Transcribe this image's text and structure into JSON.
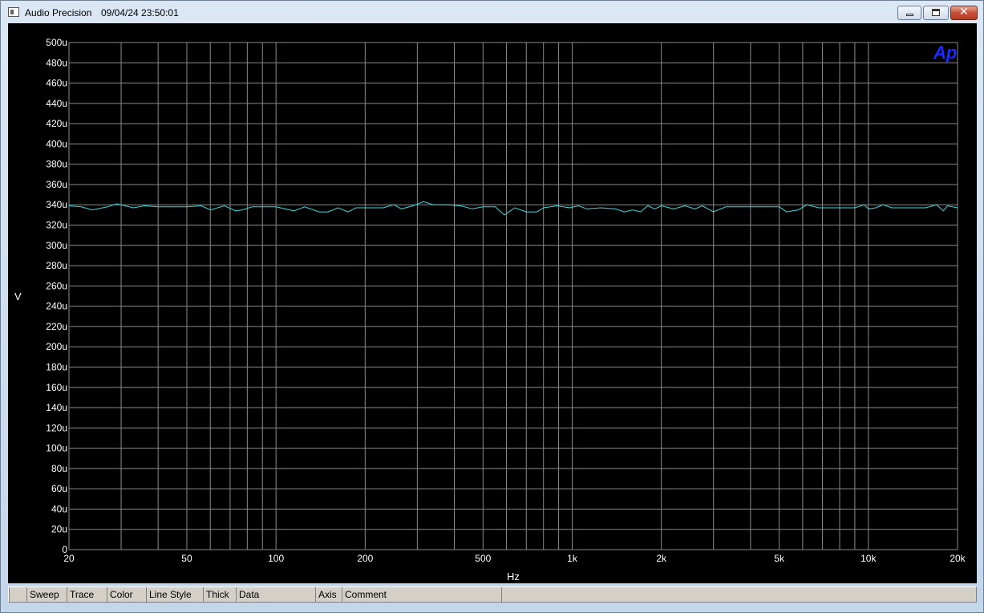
{
  "window": {
    "title": "Audio Precision",
    "timestamp": "09/04/24 23:50:01"
  },
  "chart_data": {
    "type": "line",
    "xscale": "log",
    "xlim": [
      20,
      20000
    ],
    "ylim": [
      0,
      500
    ],
    "yunit": "u",
    "xlabel": "Hz",
    "ylabel": "V",
    "grid": true,
    "logo": "Ap",
    "trace_color": "#38d9e0",
    "grid_color": "#8a8a8a",
    "y_ticks": [
      0,
      20,
      40,
      60,
      80,
      100,
      120,
      140,
      160,
      180,
      200,
      220,
      240,
      260,
      280,
      300,
      320,
      340,
      360,
      380,
      400,
      420,
      440,
      460,
      480,
      500
    ],
    "y_tick_labels": [
      "0",
      "20u",
      "40u",
      "60u",
      "80u",
      "100u",
      "120u",
      "140u",
      "160u",
      "180u",
      "200u",
      "220u",
      "240u",
      "260u",
      "280u",
      "300u",
      "320u",
      "340u",
      "360u",
      "380u",
      "400u",
      "420u",
      "440u",
      "460u",
      "480u",
      "500u"
    ],
    "x_ticks": [
      20,
      50,
      100,
      200,
      500,
      1000,
      2000,
      5000,
      10000,
      20000
    ],
    "x_tick_labels": [
      "20",
      "50",
      "100",
      "200",
      "500",
      "1k",
      "2k",
      "5k",
      "10k",
      "20k"
    ],
    "x_gridlines": [
      20,
      30,
      40,
      50,
      60,
      70,
      80,
      90,
      100,
      200,
      300,
      400,
      500,
      600,
      700,
      800,
      900,
      1000,
      2000,
      3000,
      4000,
      5000,
      6000,
      7000,
      8000,
      9000,
      10000,
      20000
    ],
    "series": [
      {
        "x": [
          20,
          22,
          24,
          27,
          29,
          33,
          36,
          40,
          45,
          50,
          56,
          60,
          67,
          73,
          77,
          83,
          89,
          100,
          115,
          125,
          140,
          150,
          162,
          175,
          186,
          200,
          230,
          250,
          265,
          290,
          315,
          340,
          380,
          420,
          460,
          500,
          550,
          590,
          640,
          700,
          760,
          800,
          890,
          980,
          1050,
          1120,
          1250,
          1400,
          1500,
          1600,
          1700,
          1800,
          1900,
          2000,
          2200,
          2400,
          2600,
          2750,
          3000,
          3300,
          3700,
          4100,
          4500,
          5000,
          5300,
          5800,
          6200,
          6800,
          7500,
          8200,
          9000,
          9700,
          10000,
          10600,
          11200,
          12000,
          13000,
          14000,
          15600,
          17000,
          17900,
          18500,
          20000
        ],
        "y": [
          339,
          338,
          335,
          338,
          341,
          337,
          339,
          338,
          338,
          338,
          339,
          335,
          339,
          334,
          335,
          338,
          338,
          338,
          334,
          338,
          333,
          333,
          337,
          333,
          337,
          337,
          337,
          340,
          336,
          339,
          343,
          340,
          340,
          339,
          336,
          338,
          338,
          330,
          337,
          333,
          333,
          337,
          339,
          337,
          339,
          336,
          337,
          336,
          333,
          335,
          333,
          339,
          336,
          339,
          336,
          339,
          336,
          339,
          333,
          338,
          338,
          338,
          338,
          338,
          333,
          335,
          340,
          337,
          337,
          337,
          337,
          340,
          336,
          337,
          340,
          337,
          337,
          337,
          337,
          340,
          334,
          339,
          337
        ]
      }
    ]
  },
  "statusbar": {
    "columns": [
      "",
      "Sweep",
      "Trace",
      "Color",
      "Line Style",
      "Thick",
      "Data",
      "Axis",
      "Comment",
      ""
    ]
  }
}
